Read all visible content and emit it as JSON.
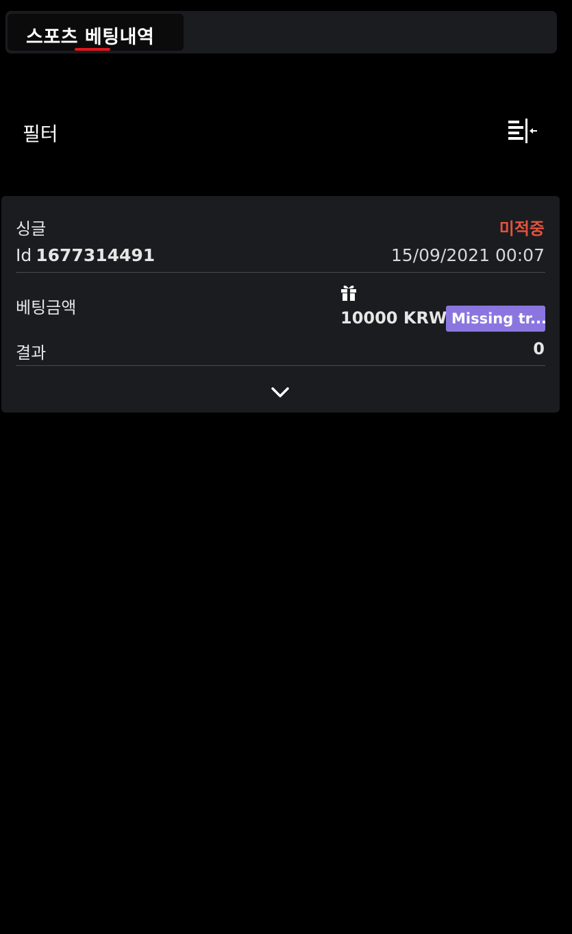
{
  "header": {
    "active_tab_label": "스포츠 베팅내역"
  },
  "filter": {
    "label": "필터",
    "toggle_icon": "collapse-filter-icon"
  },
  "bet_card": {
    "bet_type": "싱글",
    "status": "미적중",
    "id_label": "Id",
    "id_value": "1677314491",
    "datetime": "15/09/2021 00:07",
    "stake_label": "베팅금액",
    "stake_icon": "gift-icon",
    "stake_amount": "10000 KRW",
    "promo_badge": "Missing tr...",
    "result_label": "결과",
    "result_value": "0",
    "expand_icon": "chevron-down-icon"
  },
  "colors": {
    "background": "#000000",
    "panel": "#1b1c20",
    "accent_red": "#e0161b",
    "status_lost": "#e5533d",
    "promo_badge": "#8b76e0"
  }
}
